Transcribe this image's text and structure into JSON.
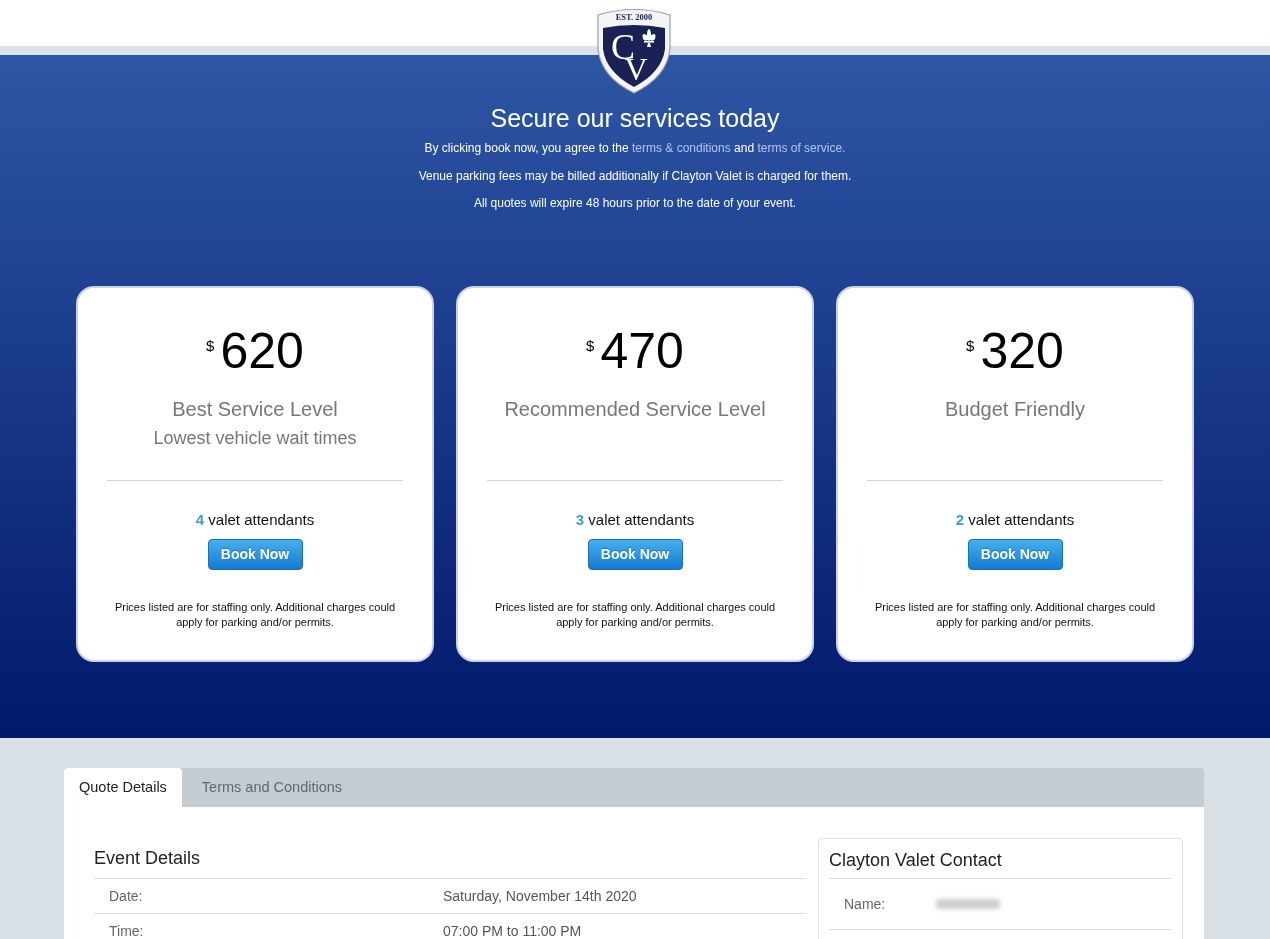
{
  "logo": {
    "established": "EST. 2000",
    "monogram": [
      "C",
      "V"
    ]
  },
  "hero": {
    "title": "Secure our services today",
    "notices": [
      {
        "segments": [
          {
            "kind": "text",
            "text": "By clicking book now, you agree to the "
          },
          {
            "kind": "link",
            "text": "terms & conditions"
          },
          {
            "kind": "text",
            "text": " and "
          },
          {
            "kind": "link",
            "text": "terms of service."
          }
        ]
      },
      {
        "segments": [
          {
            "kind": "text",
            "text": "Venue parking fees may be billed additionally if Clayton Valet is charged for them."
          }
        ]
      },
      {
        "segments": [
          {
            "kind": "text",
            "text": "All quotes will expire 48 hours prior to the date of your event."
          }
        ]
      }
    ]
  },
  "plans": [
    {
      "currency": "$",
      "price": "620",
      "title": "Best Service Level",
      "subtitle": "Lowest vehicle wait times",
      "attendants_count": "4",
      "attendants_label": "valet attendants",
      "button": "Book Now",
      "note": "Prices listed are for staffing only. Additional charges could apply for parking and/or permits."
    },
    {
      "currency": "$",
      "price": "470",
      "title": "Recommended Service Level",
      "attendants_count": "3",
      "attendants_label": "valet attendants",
      "button": "Book Now",
      "note": "Prices listed are for staffing only. Additional charges could apply for parking and/or permits."
    },
    {
      "currency": "$",
      "price": "320",
      "title": "Budget Friendly",
      "attendants_count": "2",
      "attendants_label": "valet attendants",
      "button": "Book Now",
      "note": "Prices listed are for staffing only. Additional charges could apply for parking and/or permits."
    }
  ],
  "tabs": [
    {
      "label": "Quote Details",
      "selected": true
    },
    {
      "label": "Terms and Conditions",
      "selected": false
    }
  ],
  "event_details": {
    "title": "Event Details",
    "rows": [
      {
        "label": "Date:",
        "value": "Saturday, November 14th 2020"
      },
      {
        "label": "Time:",
        "value": "07:00 PM to 11:00 PM"
      }
    ]
  },
  "contact": {
    "title": "Clayton Valet Contact",
    "rows": [
      {
        "label": "Name:",
        "blurred": true
      }
    ]
  }
}
